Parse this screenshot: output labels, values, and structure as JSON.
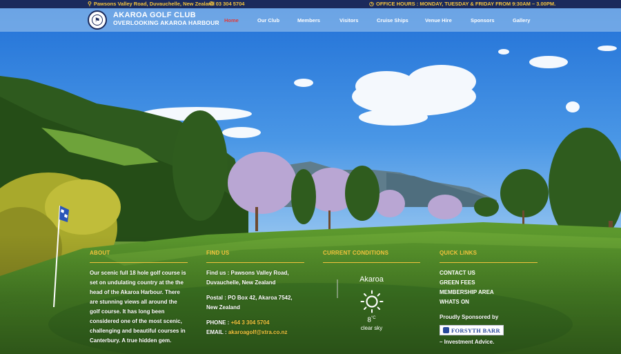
{
  "topbar": {
    "address": "Pawsons Valley Road, Duvauchelle, New Zealand",
    "phone": "03 304 5704",
    "hours": "OFFICE HOURS : MONDAY, TUESDAY & FRIDAY FROM 9:30AM – 3.00PM."
  },
  "brand": {
    "name": "AKAROA GOLF CLUB",
    "tagline": "OVERLOOKING AKAROA HARBOUR"
  },
  "nav": [
    "Home",
    "Our Club",
    "Members",
    "Visitors",
    "Cruise Ships",
    "Venue Hire",
    "Sponsors",
    "Gallery"
  ],
  "nav_active": "Home",
  "about": {
    "heading": "ABOUT",
    "text": "Our scenic full 18 hole golf course is set on undulating country at the the head of the Akaroa Harbour. There are stunning views all around the golf course. It has long been considered one of the most scenic, challenging and beautiful courses in Canterbury. A true hidden gem."
  },
  "find_us": {
    "heading": "FIND US",
    "address": "Find us : Pawsons Valley Road, Duvauchelle, New Zealand",
    "postal": "Postal : PO Box 42, Akaroa 7542, New Zealand",
    "phone_label": "PHONE : ",
    "phone": "+64 3 304 5704",
    "email_label": "EMAIL : ",
    "email": "akaroagolf@xtra.co.nz"
  },
  "conditions": {
    "heading": "CURRENT CONDITIONS",
    "city": "Akaroa",
    "temp": "8",
    "unit": "°C",
    "description": "clear sky"
  },
  "quick_links": {
    "heading": "QUICK LINKS",
    "links": [
      "CONTACT US",
      "GREEN FEES",
      "MEMBERSHIP AREA",
      "WHATS ON"
    ],
    "sponsored_by": "Proudly Sponsored by",
    "sponsor_name": "FORSYTH BARR",
    "sponsor_tagline": "– Investment Advice."
  },
  "colors": {
    "topbar_bg": "#1b2a5c",
    "accent_gold": "#f4c33d",
    "nav_active": "#e03a3a"
  },
  "icons": [
    "map-pin-icon",
    "phone-icon",
    "clock-icon",
    "sun-icon",
    "club-crest-icon",
    "sponsor-logo-icon"
  ]
}
